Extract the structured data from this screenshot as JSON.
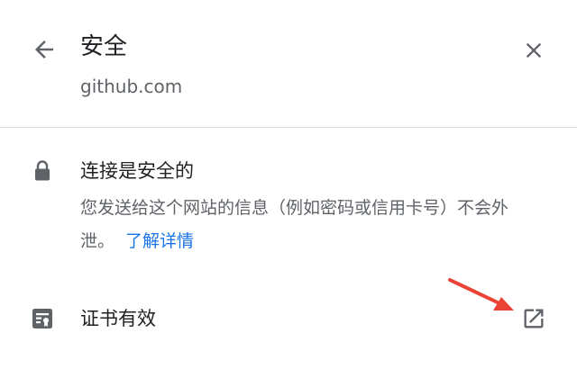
{
  "header": {
    "title": "安全",
    "subtitle": "github.com",
    "back_icon": "arrow-back-icon",
    "close_icon": "close-icon"
  },
  "connection": {
    "icon": "lock-icon",
    "title": "连接是安全的",
    "description": "您发送给这个网站的信息（例如密码或信用卡号）不会外泄。",
    "learn_more": "了解详情"
  },
  "certificate": {
    "icon": "certificate-icon",
    "label": "证书有效",
    "external_icon": "open-in-new-icon"
  },
  "colors": {
    "link": "#1a73e8",
    "annotation_arrow": "#ea4335",
    "text_primary": "#202124",
    "text_secondary": "#5f6368"
  }
}
